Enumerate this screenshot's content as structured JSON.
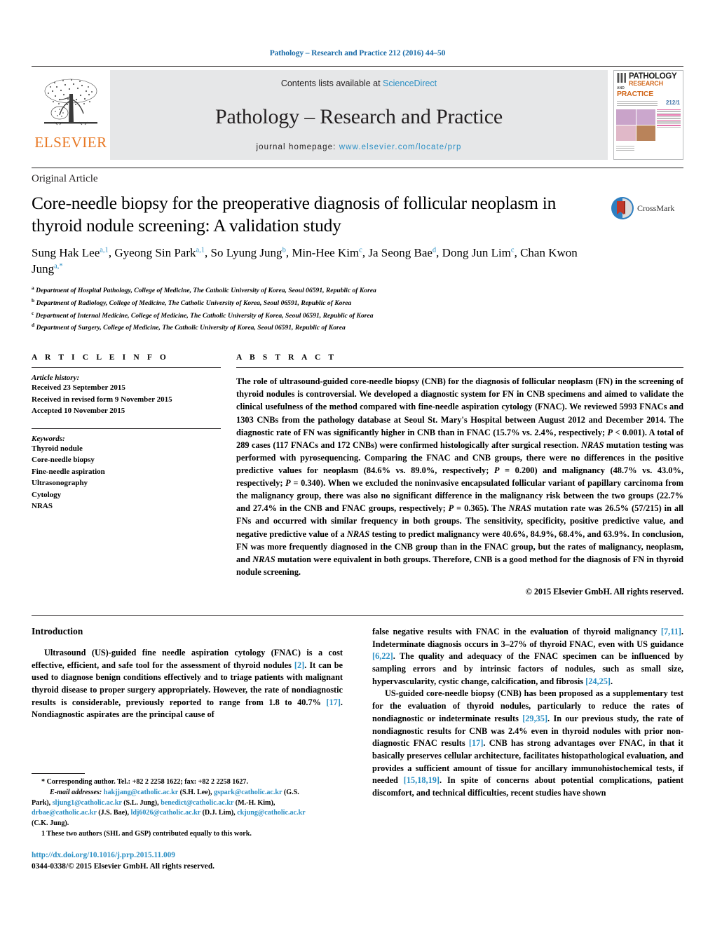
{
  "running_head": "Pathology – Research and Practice 212 (2016) 44–50",
  "masthead": {
    "publisher_name": "ELSEVIER",
    "contents_prefix": "Contents lists available at ",
    "sciencedirect": "ScienceDirect",
    "journal_title": "Pathology – Research and Practice",
    "homepage_label": "journal homepage:",
    "homepage_url": "www.elsevier.com/locate/prp",
    "cover": {
      "line1": "PATHOLOGY",
      "line2": "RESEARCH",
      "line3": "AND",
      "line4": "PRACTICE",
      "volume": "212/1"
    }
  },
  "article": {
    "type": "Original Article",
    "title": "Core-needle biopsy for the preoperative diagnosis of follicular neoplasm in thyroid nodule screening: A validation study",
    "crossmark_label": "CrossMark",
    "authors_html": "Sung Hak Lee<sup>a,1</sup>, Gyeong Sin Park<sup>a,1</sup>, So Lyung Jung<sup>b</sup>, Min-Hee Kim<sup>c</sup>, Ja Seong Bae<sup>d</sup>, Dong Jun Lim<sup>c</sup>, Chan Kwon Jung<sup>a,*</sup>",
    "affiliations": [
      {
        "marker": "a",
        "text": "Department of Hospital Pathology, College of Medicine, The Catholic University of Korea, Seoul 06591, Republic of Korea"
      },
      {
        "marker": "b",
        "text": "Department of Radiology, College of Medicine, The Catholic University of Korea, Seoul 06591, Republic of Korea"
      },
      {
        "marker": "c",
        "text": "Department of Internal Medicine, College of Medicine, The Catholic University of Korea, Seoul 06591, Republic of Korea"
      },
      {
        "marker": "d",
        "text": "Department of Surgery, College of Medicine, The Catholic University of Korea, Seoul 06591, Republic of Korea"
      }
    ]
  },
  "article_info": {
    "heading": "A R T I C L E    I N F O",
    "history_label": "Article history:",
    "history": [
      "Received 23 September 2015",
      "Received in revised form 9 November 2015",
      "Accepted 10 November 2015"
    ],
    "keywords_label": "Keywords:",
    "keywords": [
      "Thyroid nodule",
      "Core-needle biopsy",
      "Fine-needle aspiration",
      "Ultrasonography",
      "Cytology",
      "NRAS"
    ]
  },
  "abstract": {
    "heading": "A B S T R A C T",
    "text": "The role of ultrasound-guided core-needle biopsy (CNB) for the diagnosis of follicular neoplasm (FN) in the screening of thyroid nodules is controversial. We developed a diagnostic system for FN in CNB specimens and aimed to validate the clinical usefulness of the method compared with fine-needle aspiration cytology (FNAC). We reviewed 5993 FNACs and 1303 CNBs from the pathology database at Seoul St. Mary's Hospital between August 2012 and December 2014. The diagnostic rate of FN was significantly higher in CNB than in FNAC (15.7% vs. 2.4%, respectively; P < 0.001). A total of 289 cases (117 FNACs and 172 CNBs) were confirmed histologically after surgical resection. NRAS mutation testing was performed with pyrosequencing. Comparing the FNAC and CNB groups, there were no differences in the positive predictive values for neoplasm (84.6% vs. 89.0%, respectively; P = 0.200) and malignancy (48.7% vs. 43.0%, respectively; P = 0.340). When we excluded the noninvasive encapsulated follicular variant of papillary carcinoma from the malignancy group, there was also no significant difference in the malignancy risk between the two groups (22.7% and 27.4% in the CNB and FNAC groups, respectively; P = 0.365). The NRAS mutation rate was 26.5% (57/215) in all FNs and occurred with similar frequency in both groups. The sensitivity, specificity, positive predictive value, and negative predictive value of a NRAS testing to predict malignancy were 40.6%, 84.9%, 68.4%, and 63.9%. In conclusion, FN was more frequently diagnosed in the CNB group than in the FNAC group, but the rates of malignancy, neoplasm, and NRAS mutation were equivalent in both groups. Therefore, CNB is a good method for the diagnosis of FN in thyroid nodule screening.",
    "copyright": "© 2015 Elsevier GmbH. All rights reserved."
  },
  "introduction": {
    "heading": "Introduction",
    "left_paragraph": "Ultrasound (US)-guided fine needle aspiration cytology (FNAC) is a cost effective, efficient, and safe tool for the assessment of thyroid nodules [2]. It can be used to diagnose benign conditions effectively and to triage patients with malignant thyroid disease to proper surgery appropriately. However, the rate of nondiagnostic results is considerable, previously reported to range from 1.8 to 40.7% [17]. Nondiagnostic aspirates are the principal cause of",
    "right_paragraph_1": "false negative results with FNAC in the evaluation of thyroid malignancy [7,11]. Indeterminate diagnosis occurs in 3–27% of thyroid FNAC, even with US guidance [6,22]. The quality and adequacy of the FNAC specimen can be influenced by sampling errors and by intrinsic factors of nodules, such as small size, hypervascularity, cystic change, calcification, and fibrosis [24,25].",
    "right_paragraph_2": "US-guided core-needle biopsy (CNB) has been proposed as a supplementary test for the evaluation of thyroid nodules, particularly to reduce the rates of nondiagnostic or indeterminate results [29,35]. In our previous study, the rate of nondiagnostic results for CNB was 2.4% even in thyroid nodules with prior non-diagnostic FNAC results [17]. CNB has strong advantages over FNAC, in that it basically preserves cellular architecture, facilitates histopathological evaluation, and provides a sufficient amount of tissue for ancillary immunohistochemical tests, if needed [15,18,19]. In spite of concerns about potential complications, patient discomfort, and technical difficulties, recent studies have shown"
  },
  "footnotes": {
    "corresponding": "* Corresponding author. Tel.: +82 2 2258 1622; fax: +82 2 2258 1627.",
    "email_label": "E-mail addresses:",
    "emails": [
      {
        "address": "hakjjang@catholic.ac.kr",
        "owner": "(S.H. Lee)"
      },
      {
        "address": "gspark@catholic.ac.kr",
        "owner": "(G.S. Park)"
      },
      {
        "address": "sljung1@catholic.ac.kr",
        "owner": "(S.L. Jung)"
      },
      {
        "address": "benedict@catholic.ac.kr",
        "owner": "(M.-H. Kim)"
      },
      {
        "address": "drbae@catholic.ac.kr",
        "owner": "(J.S. Bae)"
      },
      {
        "address": "ldj6026@catholic.ac.kr",
        "owner": "(D.J. Lim)"
      },
      {
        "address": "ckjung@catholic.ac.kr",
        "owner": "(C.K. Jung)"
      }
    ],
    "equal_contribution": "1  These two authors (SHL and GSP) contributed equally to this work."
  },
  "doi_block": {
    "doi": "http://dx.doi.org/10.1016/j.prp.2015.11.009",
    "issn_copyright": "0344-0338/© 2015 Elsevier GmbH. All rights reserved."
  },
  "colors": {
    "link_blue": "#2b8fc4",
    "header_blue": "#1b6ca8",
    "elsevier_orange": "#e87722",
    "band_grey": "#e6e7e8"
  }
}
